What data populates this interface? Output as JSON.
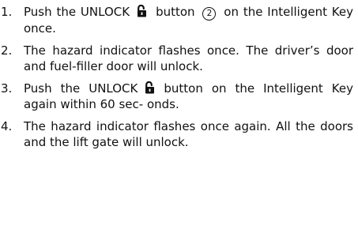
{
  "steps": [
    {
      "number": "1.",
      "text_before_icon": "Push the UNLOCK",
      "icon": "unlock-icon",
      "text_after_icon": "button",
      "callout": "2",
      "text_end": "on the Intelligent Key once."
    },
    {
      "number": "2.",
      "text": "The hazard indicator flashes once. The driver’s door and fuel-filler door will unlock."
    },
    {
      "number": "3.",
      "text_before_icon": "Push the UNLOCK",
      "icon": "unlock-icon",
      "text_after_icon": "button on the Intelligent Key again within 60 sec- onds."
    },
    {
      "number": "4.",
      "text": "The hazard indicator flashes once again. All the doors and the lift gate will unlock."
    }
  ]
}
